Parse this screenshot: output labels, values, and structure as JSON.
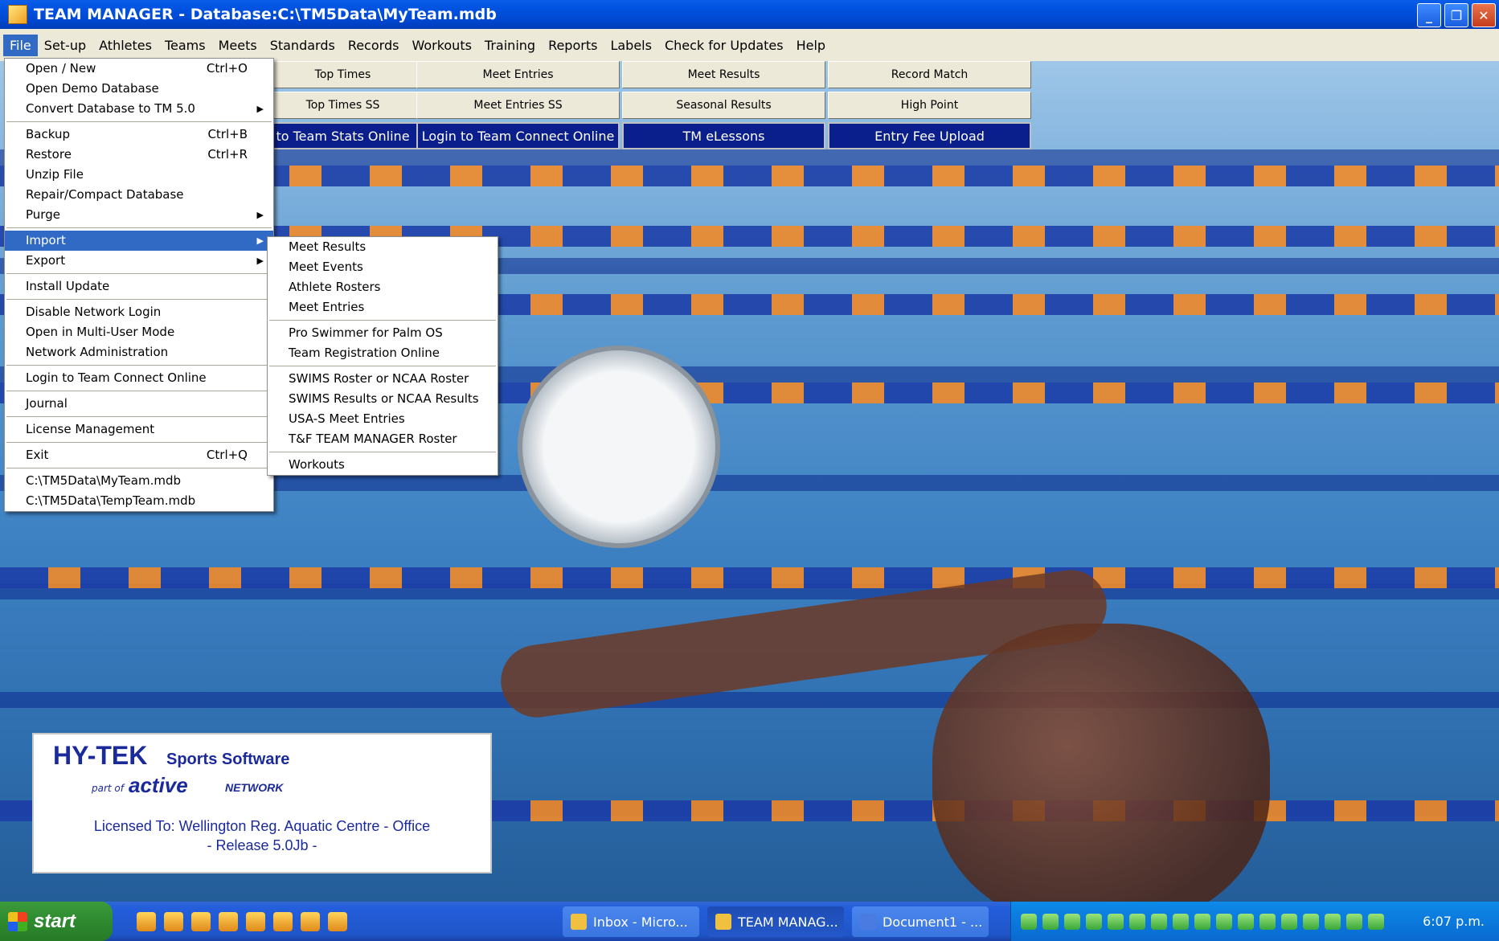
{
  "window": {
    "title": "TEAM MANAGER - Database:C:\\TM5Data\\MyTeam.mdb",
    "controls": {
      "minimize": "_",
      "maximize": "❐",
      "close": "✕"
    }
  },
  "menubar": [
    "File",
    "Set-up",
    "Athletes",
    "Teams",
    "Meets",
    "Standards",
    "Records",
    "Workouts",
    "Training",
    "Reports",
    "Labels",
    "Check for Updates",
    "Help"
  ],
  "toolbar": {
    "row1": [
      "Top Times",
      "Meet Entries",
      "Meet Results",
      "Record Match"
    ],
    "row2": [
      "Top Times SS",
      "Meet Entries SS",
      "Seasonal Results",
      "High Point"
    ],
    "row3": [
      "to Team Stats Online",
      "Login to Team Connect Online",
      "TM eLessons",
      "Entry Fee Upload"
    ]
  },
  "file_menu": {
    "items": [
      {
        "label": "Open / New",
        "shortcut": "Ctrl+O"
      },
      {
        "label": "Open Demo Database"
      },
      {
        "label": "Convert Database to TM 5.0",
        "submenu": true
      },
      {
        "sep": true
      },
      {
        "label": "Backup",
        "shortcut": "Ctrl+B"
      },
      {
        "label": "Restore",
        "shortcut": "Ctrl+R"
      },
      {
        "label": "Unzip File"
      },
      {
        "label": "Repair/Compact Database"
      },
      {
        "label": "Purge",
        "submenu": true
      },
      {
        "sep": true
      },
      {
        "label": "Import",
        "submenu": true,
        "selected": true
      },
      {
        "label": "Export",
        "submenu": true
      },
      {
        "sep": true
      },
      {
        "label": "Install Update"
      },
      {
        "sep": true
      },
      {
        "label": "Disable Network Login"
      },
      {
        "label": "Open in Multi-User Mode"
      },
      {
        "label": "Network Administration"
      },
      {
        "sep": true
      },
      {
        "label": "Login to Team Connect Online"
      },
      {
        "sep": true
      },
      {
        "label": "Journal"
      },
      {
        "sep": true
      },
      {
        "label": "License Management"
      },
      {
        "sep": true
      },
      {
        "label": "Exit",
        "shortcut": "Ctrl+Q"
      },
      {
        "sep": true
      },
      {
        "label": "C:\\TM5Data\\MyTeam.mdb"
      },
      {
        "label": "C:\\TM5Data\\TempTeam.mdb"
      }
    ]
  },
  "import_menu": {
    "items": [
      {
        "label": "Meet Results"
      },
      {
        "label": "Meet Events"
      },
      {
        "label": "Athlete Rosters"
      },
      {
        "label": "Meet Entries"
      },
      {
        "sep": true
      },
      {
        "label": "Pro Swimmer for Palm OS"
      },
      {
        "label": "Team Registration Online"
      },
      {
        "sep": true
      },
      {
        "label": "SWIMS Roster or NCAA Roster"
      },
      {
        "label": "SWIMS Results or NCAA Results"
      },
      {
        "label": "USA-S Meet Entries"
      },
      {
        "label": "T&F TEAM MANAGER Roster"
      },
      {
        "sep": true
      },
      {
        "label": "Workouts"
      }
    ]
  },
  "logo": {
    "brand": "HY-TEK",
    "tagline": "Sports Software",
    "part_of": "part of",
    "active": "active",
    "network": "NETWORK",
    "licensed": "Licensed To:  Wellington Reg. Aquatic Centre - Office",
    "release": "- Release 5.0Jb -"
  },
  "taskbar": {
    "start": "start",
    "tasks": [
      "Inbox - Micro...",
      "TEAM MANAG...",
      "Document1 - ..."
    ],
    "clock": "6:07 p.m."
  }
}
